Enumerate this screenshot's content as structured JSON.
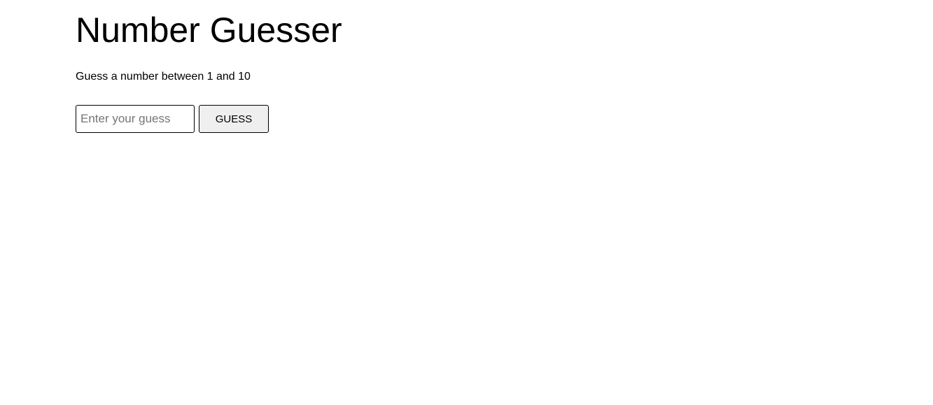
{
  "app": {
    "title": "Number Guesser",
    "instructions": "Guess a number between 1 and 10"
  },
  "form": {
    "guess_input": {
      "value": "",
      "placeholder": "Enter your guess"
    },
    "guess_button_label": "GUESS"
  },
  "colors": {
    "background": "#ffffff",
    "text": "#000000",
    "button_background": "#efefef",
    "placeholder": "#757575"
  }
}
